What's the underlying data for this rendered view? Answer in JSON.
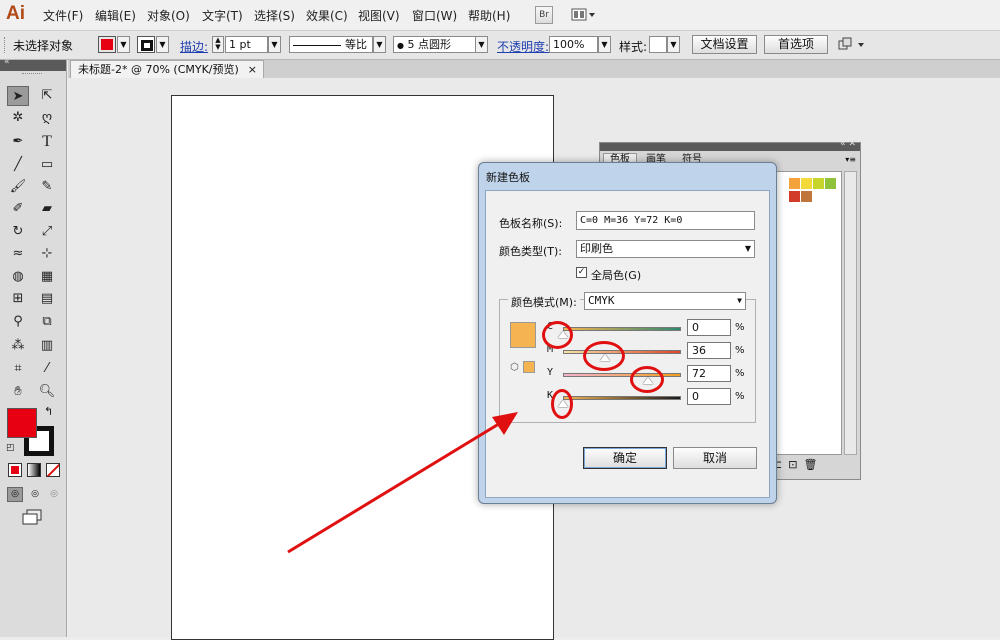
{
  "menubar": {
    "app_logo": "Ai",
    "items": [
      "文件(F)",
      "编辑(E)",
      "对象(O)",
      "文字(T)",
      "选择(S)",
      "效果(C)",
      "视图(V)",
      "窗口(W)",
      "帮助(H)"
    ],
    "bridge_label": "Br"
  },
  "controlbar": {
    "selection_status": "未选择对象",
    "stroke_label": "描边:",
    "stroke_weight": "1 pt",
    "stroke_style": "等比",
    "brush": "5 点圆形",
    "opacity_label": "不透明度:",
    "opacity_value": "100%",
    "style_label": "样式:",
    "doc_setup_button": "文档设置",
    "prefs_button": "首选项"
  },
  "document_tab": {
    "title": "未标题-2* @ 70% (CMYK/预览)",
    "close": "×"
  },
  "swatch_panel": {
    "tabs": [
      "色板",
      "画笔",
      "符号"
    ],
    "swatch_colors": [
      "#f4a33c",
      "#f4d93a",
      "#c6d42b",
      "#8fc23a",
      "#d23a2a",
      "#c0763a"
    ]
  },
  "dialog": {
    "title": "新建色板",
    "name_label": "色板名称(S):",
    "name_value": "C=0 M=36 Y=72 K=0",
    "type_label": "颜色类型(T):",
    "type_value": "印刷色",
    "global_label": "全局色(G)",
    "global_checked": true,
    "mode_label": "颜色模式(M):",
    "mode_value": "CMYK",
    "preview_color": "#f6b351",
    "channels": [
      {
        "label": "C",
        "value": "0",
        "fraction": 0.0
      },
      {
        "label": "M",
        "value": "36",
        "fraction": 0.36
      },
      {
        "label": "Y",
        "value": "72",
        "fraction": 0.72
      },
      {
        "label": "K",
        "value": "0",
        "fraction": 0.0
      }
    ],
    "percent_sign": "%",
    "ok_button": "确定",
    "cancel_button": "取消"
  },
  "colors": {
    "fill": "#e60012",
    "annotation": "#e01010"
  }
}
